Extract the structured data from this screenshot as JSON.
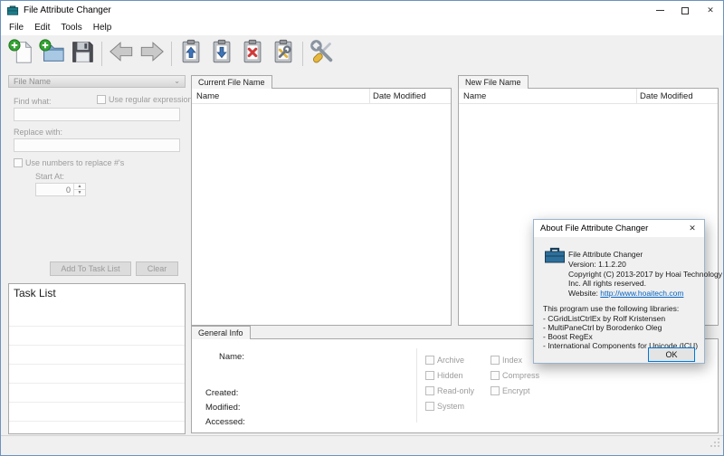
{
  "window": {
    "title": "File Attribute Changer"
  },
  "icons": {
    "close": "✕",
    "chevron_down": "⌄",
    "spin_up": "▲",
    "spin_down": "▼"
  },
  "menu": {
    "items": [
      "File",
      "Edit",
      "Tools",
      "Help"
    ]
  },
  "toolbar": {
    "icons": [
      "add-files",
      "add-folder",
      "save",
      "back",
      "forward",
      "paste-up",
      "paste-down",
      "remove",
      "apply",
      "settings"
    ]
  },
  "rename_panel": {
    "header": "File Name",
    "find_label": "Find what:",
    "regex_label": "Use regular expression",
    "find_value": "",
    "replace_label": "Replace with:",
    "replace_value": "",
    "numbers_label": "Use numbers to replace #'s",
    "start_at_label": "Start At:",
    "start_at_value": "0",
    "add_button": "Add To Task List",
    "clear_button": "Clear"
  },
  "task_list": {
    "title": "Task List"
  },
  "current_pane": {
    "tab": "Current File Name",
    "columns": [
      "Name",
      "Date Modified"
    ],
    "rows": []
  },
  "new_pane": {
    "tab": "New File Name",
    "columns": [
      "Name",
      "Date Modified"
    ],
    "rows": []
  },
  "general_info": {
    "tab": "General Info",
    "name_label": "Name:",
    "created_label": "Created:",
    "modified_label": "Modified:",
    "accessed_label": "Accessed:",
    "attributes_col1": [
      "Archive",
      "Hidden",
      "Read-only",
      "System"
    ],
    "attributes_col2": [
      "Index",
      "Compress",
      "Encrypt"
    ]
  },
  "about_dialog": {
    "title": "About File Attribute Changer",
    "app_name": "File Attribute Changer",
    "version_line": "Version:   1.1.2.20",
    "copyright_line1": "Copyright (C) 2013-2017 by Hoai Technology",
    "copyright_line2": "Inc.   All rights reserved.",
    "website_label": "Website:",
    "website_url": "http://www.hoaitech.com",
    "libraries_intro": "This program use the following libraries:",
    "libraries": [
      "- CGridListCtrlEx by Rolf Kristensen",
      "- MultiPaneCtrl by Borodenko Oleg",
      "- Boost RegEx",
      "- International Components for Unicode (ICU)"
    ],
    "ok_button": "OK"
  },
  "colors": {
    "link": "#0563c1",
    "focus_border": "#0078d7"
  }
}
